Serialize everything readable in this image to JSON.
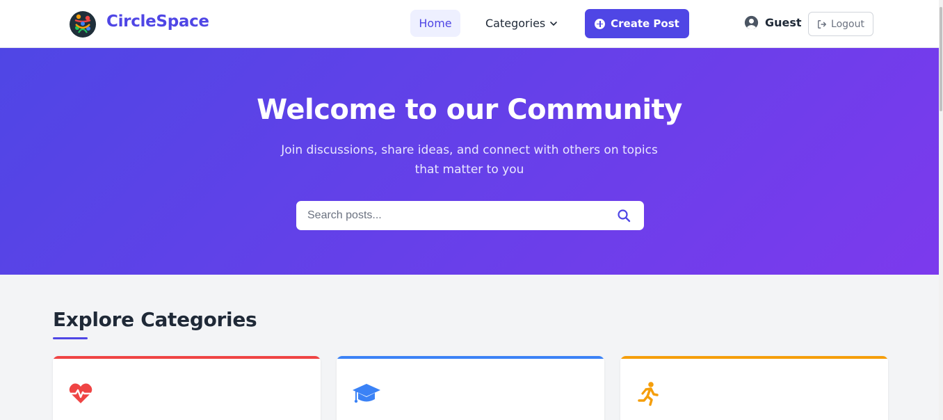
{
  "brand": {
    "name": "CircleSpace",
    "logo_icon": "circle-people-logo"
  },
  "nav": {
    "home_label": "Home",
    "categories_label": "Categories",
    "create_post_label": "Create Post",
    "user_label": "Guest",
    "logout_label": "Logout"
  },
  "hero": {
    "title": "Welcome to our Community",
    "subtitle": "Join discussions, share ideas, and connect with others on topics that matter to you",
    "search_placeholder": "Search posts..."
  },
  "content": {
    "section_title": "Explore Categories"
  },
  "categories": [
    {
      "icon": "heartbeat-icon",
      "accent": "#ef4444"
    },
    {
      "icon": "graduation-cap-icon",
      "accent": "#3b82f6"
    },
    {
      "icon": "running-icon",
      "accent": "#f59e0b"
    }
  ],
  "colors": {
    "primary": "#4f46e5",
    "hero_start": "#4f46e5",
    "hero_end": "#7c3aed"
  }
}
